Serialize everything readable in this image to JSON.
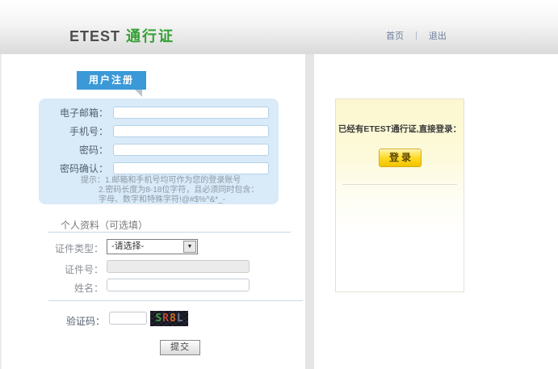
{
  "header": {
    "brand": {
      "name": "ETEST",
      "suffix": "通行证"
    },
    "nav": {
      "home": "首页",
      "separator": "|",
      "logout": "退出"
    }
  },
  "register": {
    "tab": "用户注册",
    "fields": [
      {
        "label": "电子邮箱：",
        "value": ""
      },
      {
        "label": "手机号：",
        "value": ""
      },
      {
        "label": "密码：",
        "value": ""
      },
      {
        "label": "密码确认：",
        "value": ""
      }
    ],
    "hint_line1": "提示：1.邮箱和手机号均可作为您的登录账号",
    "hint_line2": "2.密码长度为8-18位字符，且必须同时包含：字母、数字和特殊字符!@#$%^&*_-"
  },
  "profile": {
    "section_title": "个人资料（可选填）",
    "id_type": {
      "label": "证件类型：",
      "selected": "-请选择-"
    },
    "id_number": {
      "label": "证件号：",
      "value": ""
    },
    "name": {
      "label": "姓名：",
      "value": ""
    }
  },
  "captcha": {
    "label": "验证码：",
    "value": "",
    "code": "SR8L",
    "chars": [
      "S",
      "R",
      "8",
      "L"
    ]
  },
  "submit_label": "提交",
  "login_panel": {
    "message": "已经有ETEST通行证,直接登录：",
    "button": "登录"
  },
  "colors": {
    "tab_blue": "#3b99d8",
    "form_panel_blue": "#d9eaf8",
    "logo_green": "#33a033",
    "nav_link": "#6e7f9e",
    "login_panel_yellow": "#fcf7cf",
    "login_button_yellow": "#fdda25",
    "captcha_bg": "#15151f",
    "captcha_letter_colors": [
      "#3f9b3f",
      "#b94a3c",
      "#d2691e",
      "#6b7b94"
    ]
  }
}
